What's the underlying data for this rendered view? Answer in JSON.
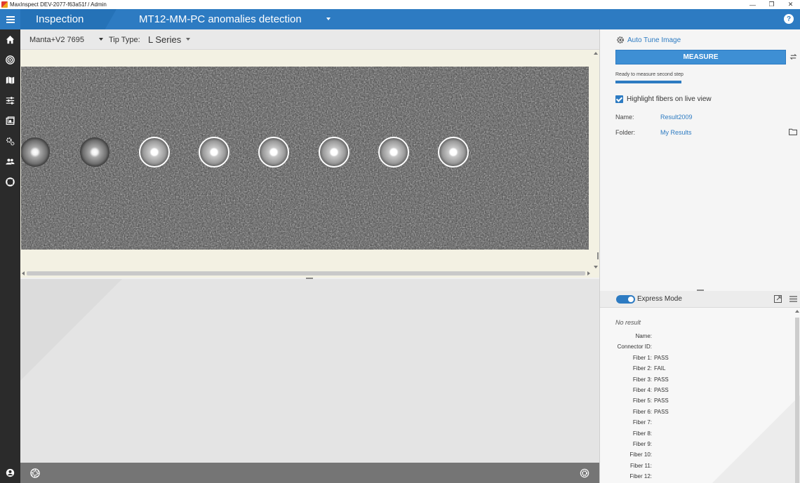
{
  "window": {
    "title": "MaxInspect DEV-2077-f63a51f / Admin",
    "controls": [
      "—",
      "❐",
      "✕"
    ]
  },
  "header": {
    "section": "Inspection",
    "page_title": "MT12-MM-PC anomalies detection",
    "help": "?",
    "accent": "#2d7bc2"
  },
  "nav": {
    "items": [
      "home-icon",
      "target-icon",
      "map-icon",
      "sliders-icon",
      "photo-icon",
      "gears-icon",
      "users-icon",
      "lifebuoy-icon",
      "account-icon"
    ]
  },
  "toolbar": {
    "camera": "Manta+V2 7695",
    "tip_type_label": "Tip Type:",
    "tip_type_value": "L Series"
  },
  "right_panel": {
    "auto_tune": "Auto Tune Image",
    "measure": "MEASURE",
    "status": "Ready to measure second step",
    "progress": 1.0,
    "highlight_label": "Highlight fibers on live view",
    "highlight_checked": true,
    "name_label": "Name:",
    "name_value": "Result2009",
    "folder_label": "Folder:",
    "folder_value": "My Results"
  },
  "results": {
    "express_mode": "Express Mode",
    "express_on": true,
    "no_result": "No result",
    "rows": [
      {
        "label": "Name:",
        "value": ""
      },
      {
        "label": "Connector ID:",
        "value": ""
      },
      {
        "label": "Fiber 1:",
        "value": "PASS"
      },
      {
        "label": "Fiber 2:",
        "value": "FAIL"
      },
      {
        "label": "Fiber 3:",
        "value": "PASS"
      },
      {
        "label": "Fiber 4:",
        "value": "PASS"
      },
      {
        "label": "Fiber 5:",
        "value": "PASS"
      },
      {
        "label": "Fiber 6:",
        "value": "PASS"
      },
      {
        "label": "Fiber 7:",
        "value": ""
      },
      {
        "label": "Fiber 8:",
        "value": ""
      },
      {
        "label": "Fiber 9:",
        "value": ""
      },
      {
        "label": "Fiber 10:",
        "value": ""
      },
      {
        "label": "Fiber 11:",
        "value": ""
      },
      {
        "label": "Fiber 12:",
        "value": ""
      }
    ]
  }
}
